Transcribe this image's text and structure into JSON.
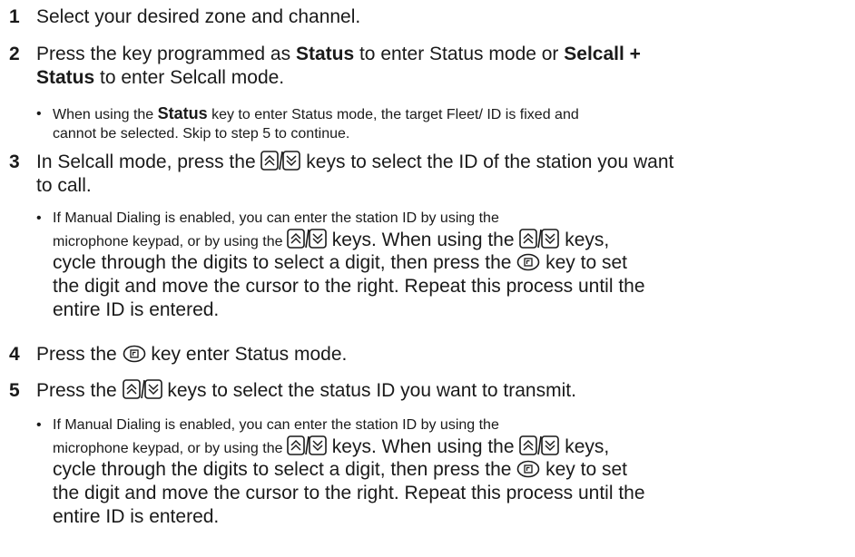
{
  "steps": [
    {
      "num": "1",
      "text": "Select your desired zone and channel."
    },
    {
      "num": "2",
      "a": "Press the key programmed as ",
      "status": "Status",
      "b": " to enter Status mode or ",
      "selcall": "Selcall +",
      "status2": "Status",
      "c": " to enter Selcall mode.",
      "bullet": {
        "a": "When using the ",
        "status": "Status",
        "b": " key to enter Status mode, the target Fleet/ ID is fixed and",
        "c": "cannot be selected.  Skip to step 5 to continue."
      }
    },
    {
      "num": "3",
      "a": "In Selcall mode, press the ",
      "b": " keys to select the ID of the station you want",
      "c": "to call.",
      "bullet": {
        "l1": "If Manual Dialing is enabled, you can enter the station ID by using the",
        "l2a": "microphone keypad, or by using the ",
        "l2b": " keys.  When using the ",
        "l2c": " keys,",
        "l3a": "cycle through the digits to select a digit, then press the ",
        "l3b": " key to set",
        "l4": "the digit and move the cursor to the right.  Repeat this process until the",
        "l5": "entire ID is entered."
      }
    },
    {
      "num": "4",
      "a": "Press the ",
      "b": " key enter Status mode."
    },
    {
      "num": "5",
      "a": "Press the ",
      "b": " keys to select the status ID you want to transmit.",
      "bullet": {
        "l1": "If Manual Dialing is enabled, you can enter the station ID by using the",
        "l2a": "microphone keypad, or by using the ",
        "l2b": " keys.  When using the ",
        "l2c": " keys,",
        "l3a": "cycle through the digits to select a digit, then press the ",
        "l3b": " key to set",
        "l4": "the digit and move the cursor to the right.  Repeat this process until the",
        "l5": "entire ID is entered."
      }
    }
  ],
  "icons": {
    "updown": "up-down-keys-icon",
    "function": "function-key-icon"
  }
}
